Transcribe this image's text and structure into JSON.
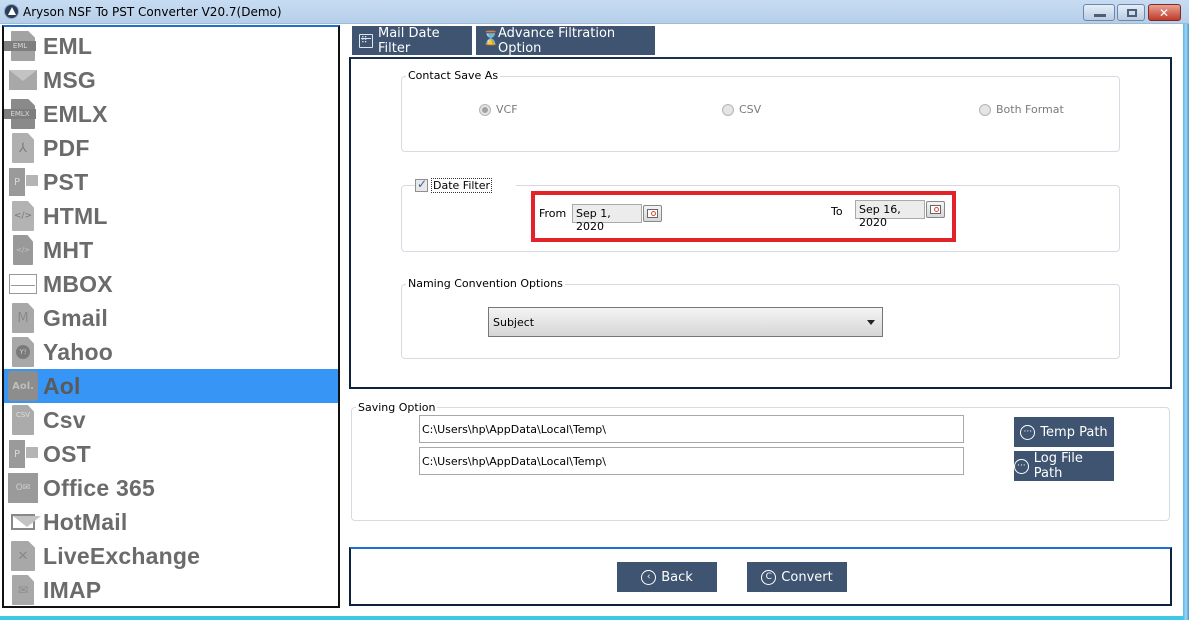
{
  "window": {
    "title": "Aryson NSF To PST Converter V20.7(Demo)",
    "controls": [
      "minimize",
      "maximize",
      "close"
    ]
  },
  "sidebar": {
    "selected": "Aol",
    "items": [
      {
        "label": "EML",
        "icon": "eml-file-icon",
        "badge": "EML"
      },
      {
        "label": "MSG",
        "icon": "envelope-icon"
      },
      {
        "label": "EMLX",
        "icon": "emlx-file-icon",
        "badge": "EMLX"
      },
      {
        "label": "PDF",
        "icon": "pdf-file-icon",
        "badge": "⅄"
      },
      {
        "label": "PST",
        "icon": "pst-outlook-icon",
        "badge": "P"
      },
      {
        "label": "HTML",
        "icon": "html-file-icon",
        "badge": "</>"
      },
      {
        "label": "MHT",
        "icon": "mht-file-icon",
        "badge": "</>"
      },
      {
        "label": "MBOX",
        "icon": "mbox-envelope-icon"
      },
      {
        "label": "Gmail",
        "icon": "gmail-icon",
        "badge": "M"
      },
      {
        "label": "Yahoo",
        "icon": "yahoo-icon",
        "badge": "Y!"
      },
      {
        "label": "Aol",
        "icon": "aol-icon",
        "badge": "Aol."
      },
      {
        "label": "Csv",
        "icon": "csv-file-icon",
        "badge": "CSV"
      },
      {
        "label": "OST",
        "icon": "ost-outlook-icon",
        "badge": "P"
      },
      {
        "label": "Office 365",
        "icon": "office365-icon",
        "badge": "O✉"
      },
      {
        "label": "HotMail",
        "icon": "hotmail-icon"
      },
      {
        "label": "LiveExchange",
        "icon": "exchange-icon",
        "badge": "✕"
      },
      {
        "label": "IMAP",
        "icon": "imap-icon",
        "badge": "✉"
      }
    ]
  },
  "tabs": [
    {
      "label": "Mail Date Filter",
      "icon": "calendar-icon"
    },
    {
      "label": "Advance Filtration Option",
      "icon": "hourglass-icon"
    }
  ],
  "contact_save_as": {
    "legend": "Contact Save As",
    "options": [
      {
        "label": "VCF",
        "checked": true
      },
      {
        "label": "CSV",
        "checked": false
      },
      {
        "label": "Both Format",
        "checked": false
      }
    ]
  },
  "date_filter": {
    "label": "Date Filter",
    "checked": true,
    "from_label": "From",
    "from_value": "Sep 1, 2020",
    "to_label": "To",
    "to_value": "Sep 16, 2020"
  },
  "naming_convention": {
    "legend": "Naming Convention Options",
    "selected": "Subject"
  },
  "saving_option": {
    "legend": "Saving Option",
    "temp_path": "C:\\Users\\hp\\AppData\\Local\\Temp\\",
    "log_path": "C:\\Users\\hp\\AppData\\Local\\Temp\\",
    "temp_button": "Temp Path",
    "log_button": "Log File Path"
  },
  "footer": {
    "back_label": "Back",
    "convert_label": "Convert"
  },
  "colors": {
    "navy_button": "#3e5470",
    "selection": "#3796f5",
    "highlight_box": "#e3232a"
  }
}
